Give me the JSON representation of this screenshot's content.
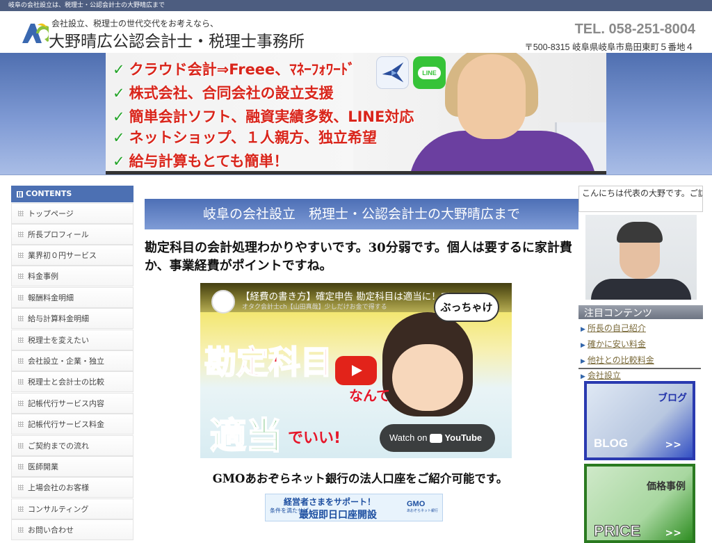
{
  "topbar": {
    "text": "岐阜の会社設立は、税理士・公認会計士の大野晴広まで"
  },
  "header": {
    "tagline": "会社設立、税理士の世代交代をお考えなら、",
    "firm_name": "大野晴広公認会計士・税理士事務所",
    "tel": "TEL. 058-251-8004",
    "address": "〒500-8315 岐阜県岐阜市島田東町５番地４"
  },
  "banner": {
    "lines": [
      "クラウド会計⇒Freee、ﾏﾈｰﾌｫﾜｰﾄﾞ",
      "株式会社、合同会社の設立支援",
      "簡単会計ソフト、融資実績多数、LINE対応",
      "ネットショップ、１人親方、独立希望",
      "給与計算もとても簡単！"
    ],
    "check": "✓",
    "line_icon_text": "LINE"
  },
  "sidebar": {
    "heading": "CONTENTS",
    "items": [
      "トップページ",
      "所長プロフィール",
      "業界初０円サービス",
      "料金事例",
      "報酬料金明細",
      "給与計算料金明細",
      "税理士を変えたい",
      "会社設立・企業・独立",
      "税理士と会計士の比較",
      "記帳代行サービス内容",
      "記帳代行サービス料金",
      "ご契約までの流れ",
      "医師開業",
      "上場会社のお客様",
      "コンサルティング",
      "お問い合わせ"
    ]
  },
  "main": {
    "title": "岐阜の会社設立　税理士・公認会計士の大野晴広まで",
    "paragraph": "勘定科目の会計処理わかりやすいです。30分弱です。個人は要するに家計費か、事業経費がポイントですね。",
    "video": {
      "title": "【経費の書き方】確定申告 勘定科目は適当に！て",
      "channel": "オタク会計士ch【山田真哉】少しだけお金で得する",
      "bubble": "ぶっちゃけ",
      "big_text_1": "勘定科目",
      "small_text_1": "なんて",
      "big_text_2": "適当",
      "small_text_2": "でいい!",
      "watch_on": "Watch on",
      "youtube": "YouTube"
    },
    "gmo_text": "GMOあおぞらネット銀行の法人口座をご紹介可能です。",
    "gmo_banner": {
      "line1": "経営者さまをサポート！",
      "small": "条件を満たせば",
      "line2": "最短即日口座開設",
      "logo": "GMO",
      "logo_sub": "あおぞらネット銀行"
    }
  },
  "right": {
    "greeting": "こんにちは代表の大野です。ご訪問ありがとうございます",
    "featured_heading": "注目コンテンツ",
    "links": [
      "所長の自己紹介",
      "確かに安い料金",
      "他社との比較料金",
      "会社設立"
    ],
    "blog": {
      "title": "ブログ",
      "label": "BLOG",
      "arrow": ">>"
    },
    "price": {
      "title": "価格事例",
      "label": "PRICE",
      "arrow": ">>"
    }
  }
}
